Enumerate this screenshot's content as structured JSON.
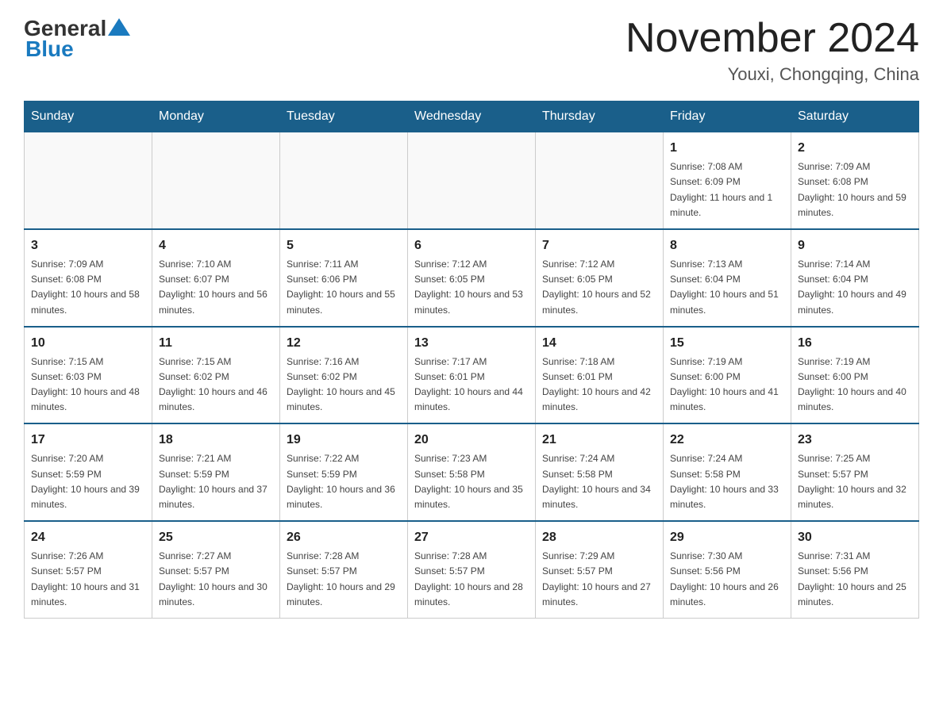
{
  "header": {
    "logo_general": "General",
    "logo_blue": "Blue",
    "month_title": "November 2024",
    "location": "Youxi, Chongqing, China"
  },
  "weekdays": [
    "Sunday",
    "Monday",
    "Tuesday",
    "Wednesday",
    "Thursday",
    "Friday",
    "Saturday"
  ],
  "weeks": [
    {
      "days": [
        {
          "number": "",
          "info": "",
          "empty": true
        },
        {
          "number": "",
          "info": "",
          "empty": true
        },
        {
          "number": "",
          "info": "",
          "empty": true
        },
        {
          "number": "",
          "info": "",
          "empty": true
        },
        {
          "number": "",
          "info": "",
          "empty": true
        },
        {
          "number": "1",
          "info": "Sunrise: 7:08 AM\nSunset: 6:09 PM\nDaylight: 11 hours and 1 minute."
        },
        {
          "number": "2",
          "info": "Sunrise: 7:09 AM\nSunset: 6:08 PM\nDaylight: 10 hours and 59 minutes."
        }
      ]
    },
    {
      "days": [
        {
          "number": "3",
          "info": "Sunrise: 7:09 AM\nSunset: 6:08 PM\nDaylight: 10 hours and 58 minutes."
        },
        {
          "number": "4",
          "info": "Sunrise: 7:10 AM\nSunset: 6:07 PM\nDaylight: 10 hours and 56 minutes."
        },
        {
          "number": "5",
          "info": "Sunrise: 7:11 AM\nSunset: 6:06 PM\nDaylight: 10 hours and 55 minutes."
        },
        {
          "number": "6",
          "info": "Sunrise: 7:12 AM\nSunset: 6:05 PM\nDaylight: 10 hours and 53 minutes."
        },
        {
          "number": "7",
          "info": "Sunrise: 7:12 AM\nSunset: 6:05 PM\nDaylight: 10 hours and 52 minutes."
        },
        {
          "number": "8",
          "info": "Sunrise: 7:13 AM\nSunset: 6:04 PM\nDaylight: 10 hours and 51 minutes."
        },
        {
          "number": "9",
          "info": "Sunrise: 7:14 AM\nSunset: 6:04 PM\nDaylight: 10 hours and 49 minutes."
        }
      ]
    },
    {
      "days": [
        {
          "number": "10",
          "info": "Sunrise: 7:15 AM\nSunset: 6:03 PM\nDaylight: 10 hours and 48 minutes."
        },
        {
          "number": "11",
          "info": "Sunrise: 7:15 AM\nSunset: 6:02 PM\nDaylight: 10 hours and 46 minutes."
        },
        {
          "number": "12",
          "info": "Sunrise: 7:16 AM\nSunset: 6:02 PM\nDaylight: 10 hours and 45 minutes."
        },
        {
          "number": "13",
          "info": "Sunrise: 7:17 AM\nSunset: 6:01 PM\nDaylight: 10 hours and 44 minutes."
        },
        {
          "number": "14",
          "info": "Sunrise: 7:18 AM\nSunset: 6:01 PM\nDaylight: 10 hours and 42 minutes."
        },
        {
          "number": "15",
          "info": "Sunrise: 7:19 AM\nSunset: 6:00 PM\nDaylight: 10 hours and 41 minutes."
        },
        {
          "number": "16",
          "info": "Sunrise: 7:19 AM\nSunset: 6:00 PM\nDaylight: 10 hours and 40 minutes."
        }
      ]
    },
    {
      "days": [
        {
          "number": "17",
          "info": "Sunrise: 7:20 AM\nSunset: 5:59 PM\nDaylight: 10 hours and 39 minutes."
        },
        {
          "number": "18",
          "info": "Sunrise: 7:21 AM\nSunset: 5:59 PM\nDaylight: 10 hours and 37 minutes."
        },
        {
          "number": "19",
          "info": "Sunrise: 7:22 AM\nSunset: 5:59 PM\nDaylight: 10 hours and 36 minutes."
        },
        {
          "number": "20",
          "info": "Sunrise: 7:23 AM\nSunset: 5:58 PM\nDaylight: 10 hours and 35 minutes."
        },
        {
          "number": "21",
          "info": "Sunrise: 7:24 AM\nSunset: 5:58 PM\nDaylight: 10 hours and 34 minutes."
        },
        {
          "number": "22",
          "info": "Sunrise: 7:24 AM\nSunset: 5:58 PM\nDaylight: 10 hours and 33 minutes."
        },
        {
          "number": "23",
          "info": "Sunrise: 7:25 AM\nSunset: 5:57 PM\nDaylight: 10 hours and 32 minutes."
        }
      ]
    },
    {
      "days": [
        {
          "number": "24",
          "info": "Sunrise: 7:26 AM\nSunset: 5:57 PM\nDaylight: 10 hours and 31 minutes."
        },
        {
          "number": "25",
          "info": "Sunrise: 7:27 AM\nSunset: 5:57 PM\nDaylight: 10 hours and 30 minutes."
        },
        {
          "number": "26",
          "info": "Sunrise: 7:28 AM\nSunset: 5:57 PM\nDaylight: 10 hours and 29 minutes."
        },
        {
          "number": "27",
          "info": "Sunrise: 7:28 AM\nSunset: 5:57 PM\nDaylight: 10 hours and 28 minutes."
        },
        {
          "number": "28",
          "info": "Sunrise: 7:29 AM\nSunset: 5:57 PM\nDaylight: 10 hours and 27 minutes."
        },
        {
          "number": "29",
          "info": "Sunrise: 7:30 AM\nSunset: 5:56 PM\nDaylight: 10 hours and 26 minutes."
        },
        {
          "number": "30",
          "info": "Sunrise: 7:31 AM\nSunset: 5:56 PM\nDaylight: 10 hours and 25 minutes."
        }
      ]
    }
  ]
}
